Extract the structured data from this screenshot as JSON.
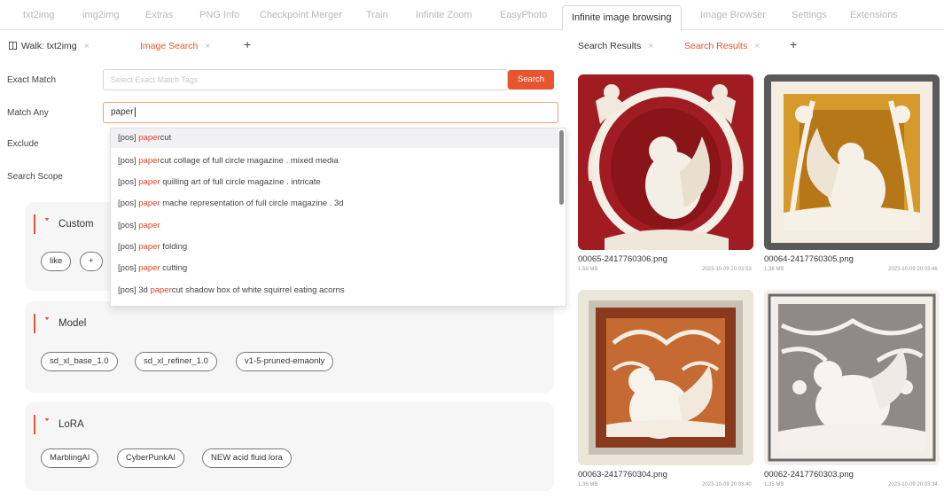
{
  "top_tabs": [
    {
      "label": "txt2img",
      "active": false
    },
    {
      "label": "img2img",
      "active": false
    },
    {
      "label": "Extras",
      "active": false
    },
    {
      "label": "PNG Info",
      "active": false
    },
    {
      "label": "Checkpoint Merger",
      "active": false
    },
    {
      "label": "Train",
      "active": false
    },
    {
      "label": "Infinite Zoom",
      "active": false
    },
    {
      "label": "EasyPhoto",
      "active": false
    },
    {
      "label": "Infinite image browsing",
      "active": true
    },
    {
      "label": "Image Browser",
      "active": false
    },
    {
      "label": "Settings",
      "active": false
    },
    {
      "label": "Extensions",
      "active": false
    }
  ],
  "left_tabs": [
    {
      "label": "Walk: txt2img",
      "active": false,
      "icon": "grid-icon"
    },
    {
      "label": "Image Search",
      "active": true
    }
  ],
  "right_tabs": [
    {
      "label": "Search Results",
      "active": false
    },
    {
      "label": "Search Results",
      "active": true
    }
  ],
  "close_glyph": "×",
  "plus_glyph": "+",
  "form": {
    "exact_label": "Exact Match",
    "exact_placeholder": "Select Exact Match Tags",
    "search_button": "Search",
    "any_label": "Match Any",
    "any_value": "paper",
    "exclude_label": "Exclude",
    "scope_label": "Search Scope"
  },
  "suggestions": [
    {
      "prefix": "[pos] ",
      "match": "paper",
      "rest": "cut",
      "highlighted": true
    },
    {
      "prefix": "[pos] ",
      "match": "paper",
      "rest": "cut collage of full circle magazine . mixed media",
      "highlighted": false
    },
    {
      "prefix": "[pos] ",
      "match": "paper",
      "rest": " quilling art of full circle magazine . intricate",
      "highlighted": false
    },
    {
      "prefix": "[pos] ",
      "match": "paper",
      "rest": " mache representation of full circle magazine . 3d",
      "highlighted": false
    },
    {
      "prefix": "[pos] ",
      "match": "paper",
      "rest": "",
      "highlighted": false
    },
    {
      "prefix": "[pos] ",
      "match": "paper",
      "rest": " folding",
      "highlighted": false
    },
    {
      "prefix": "[pos] ",
      "match": "paper",
      "rest": " cutting",
      "highlighted": false
    },
    {
      "prefix": "[pos] 3d ",
      "match": "paper",
      "rest": "cut shadow box of white squirrel eating acorns",
      "highlighted": false
    }
  ],
  "cards": {
    "custom": {
      "title": "Custom",
      "chips": [
        "like",
        "+"
      ]
    },
    "model": {
      "title": "Model",
      "chips": [
        "sd_xl_base_1.0",
        "sd_xl_refiner_1.0",
        "v1-5-pruned-emaonly"
      ]
    },
    "lora": {
      "title": "LoRA",
      "chips": [
        "MarblingAI",
        "CyberPunkAI",
        "NEW acid fluid lora"
      ]
    }
  },
  "results": [
    {
      "file": "00065-2417760306.png",
      "size": "1.58 MB",
      "date": "2023-10-09 20:03:53",
      "style": "red-oval"
    },
    {
      "file": "00064-2417760305.png",
      "size": "1.36 MB",
      "date": "2023-10-09 20:03:46",
      "style": "gold-square"
    },
    {
      "file": "00063-2417760304.png",
      "size": "1.36 MB",
      "date": "2023-10-09 20:03:40",
      "style": "copper-frame"
    },
    {
      "file": "00062-2417760303.png",
      "size": "1.35 MB",
      "date": "2023-10-09 20:03:34",
      "style": "gray-lace"
    }
  ],
  "colors": {
    "accent": "#e8542f",
    "match": "#e3432a"
  }
}
